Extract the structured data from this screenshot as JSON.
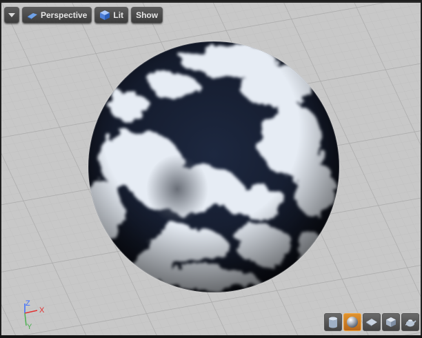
{
  "viewport": {
    "toolbar": {
      "menu_icon": "chevron-down-icon",
      "perspective_label": "Perspective",
      "perspective_icon": "perspective-icon",
      "lit_label": "Lit",
      "lit_icon": "lit-cube-icon",
      "show_label": "Show"
    },
    "axes": {
      "z": "Z",
      "x": "X",
      "y": "Y",
      "z_color": "#3b6cff",
      "x_color": "#e23030",
      "y_color": "#4caf50"
    },
    "preview_shapes": [
      {
        "name": "cylinder",
        "icon": "cylinder-icon",
        "active": false
      },
      {
        "name": "sphere",
        "icon": "sphere-icon",
        "active": true
      },
      {
        "name": "plane",
        "icon": "plane-icon",
        "active": false
      },
      {
        "name": "cube",
        "icon": "cube-icon",
        "active": false
      },
      {
        "name": "custom-mesh",
        "icon": "teapot-icon",
        "active": false
      }
    ],
    "accent_color": "#d9882a"
  }
}
